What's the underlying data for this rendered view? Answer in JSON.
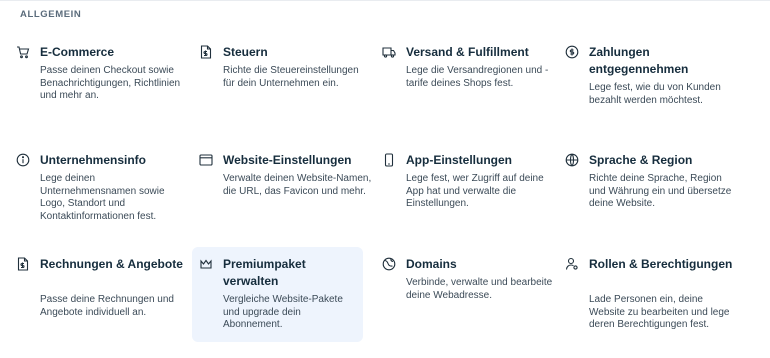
{
  "section": {
    "title": "ALLGEMEIN"
  },
  "cards": [
    {
      "title": "E-Commerce",
      "desc": "Passe deinen Checkout sowie Benachrichtigungen, Richtlinien und mehr an.",
      "icon": "cart-icon"
    },
    {
      "title": "Steuern",
      "desc": "Richte die Steuereinstellungen für dein Unternehmen ein.",
      "icon": "tax-document-icon"
    },
    {
      "title": "Versand & Fulfillment",
      "desc": "Lege die Versandregionen und -tarife deines Shops fest.",
      "icon": "truck-icon"
    },
    {
      "title": "Zahlungen entgegennehmen",
      "desc": "Lege fest, wie du von Kunden bezahlt werden möchtest.",
      "icon": "dollar-coin-icon"
    },
    {
      "title": "Unternehmensinfo",
      "desc": "Lege deinen Unternehmensnamen sowie Logo, Standort und Kontaktinformationen fest.",
      "icon": "info-icon"
    },
    {
      "title": "Website-Einstellungen",
      "desc": "Verwalte deinen Website-Namen, die URL, das Favicon und mehr.",
      "icon": "browser-window-icon"
    },
    {
      "title": "App-Einstellungen",
      "desc": "Lege fest, wer Zugriff auf deine App hat und verwalte die Einstellungen.",
      "icon": "mobile-phone-icon"
    },
    {
      "title": "Sprache & Region",
      "desc": "Richte deine Sprache, Region und Währung ein und übersetze deine Website.",
      "icon": "globe-icon"
    },
    {
      "title": "Rechnungen & Angebote",
      "desc": "Passe deine Rechnungen und Angebote individuell an.",
      "icon": "invoice-icon"
    },
    {
      "title": "Premiumpaket verwalten",
      "desc": "Vergleiche Website-Pakete und upgrade dein Abonnement.",
      "icon": "crown-icon"
    },
    {
      "title": "Domains",
      "desc": "Verbinde, verwalte und bearbeite deine Webadresse.",
      "icon": "domain-globe-icon"
    },
    {
      "title": "Rollen & Berechtigungen",
      "desc": "Lade Personen ein, deine Website zu bearbeiten und lege deren Berechtigungen fest.",
      "icon": "user-settings-icon"
    }
  ]
}
